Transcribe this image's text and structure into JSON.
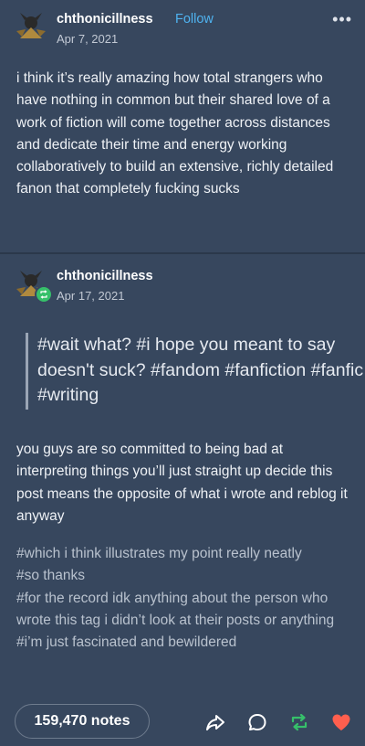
{
  "op_post": {
    "username": "chthonicillness",
    "follow_label": "Follow",
    "date": "Apr 7, 2021",
    "body": "i think it’s really amazing how total strangers who have nothing in common but their shared love of a work of fiction will come together across distances and dedicate their time and energy working collaboratively to build an extensive, richly detailed fanon that completely fucking sucks"
  },
  "reblog": {
    "username": "chthonicillness",
    "date": "Apr 17, 2021",
    "quoted_tags": "#wait what? #i hope you meant to say doesn't suck? #fandom #fanfiction #fanfic #writing",
    "body": "you guys are so committed to being bad at interpreting things you’ll just straight up decide this post means the opposite of what i wrote and reblog it anyway",
    "tags": [
      "#which i think illustrates my point really neatly",
      "#so thanks",
      "#for the record idk anything about the person who wrote this tag i didn’t look at their posts or anything",
      "#i’m just fascinated and bewildered"
    ]
  },
  "footer": {
    "notes_label": "159,470 notes",
    "icons": [
      "share-icon",
      "reply-icon",
      "reblog-icon",
      "like-icon"
    ]
  },
  "colors": {
    "background": "#37475e",
    "accent_follow": "#4fb3f0",
    "reblog_green": "#36c06a",
    "like_red": "#ff5f4e"
  }
}
